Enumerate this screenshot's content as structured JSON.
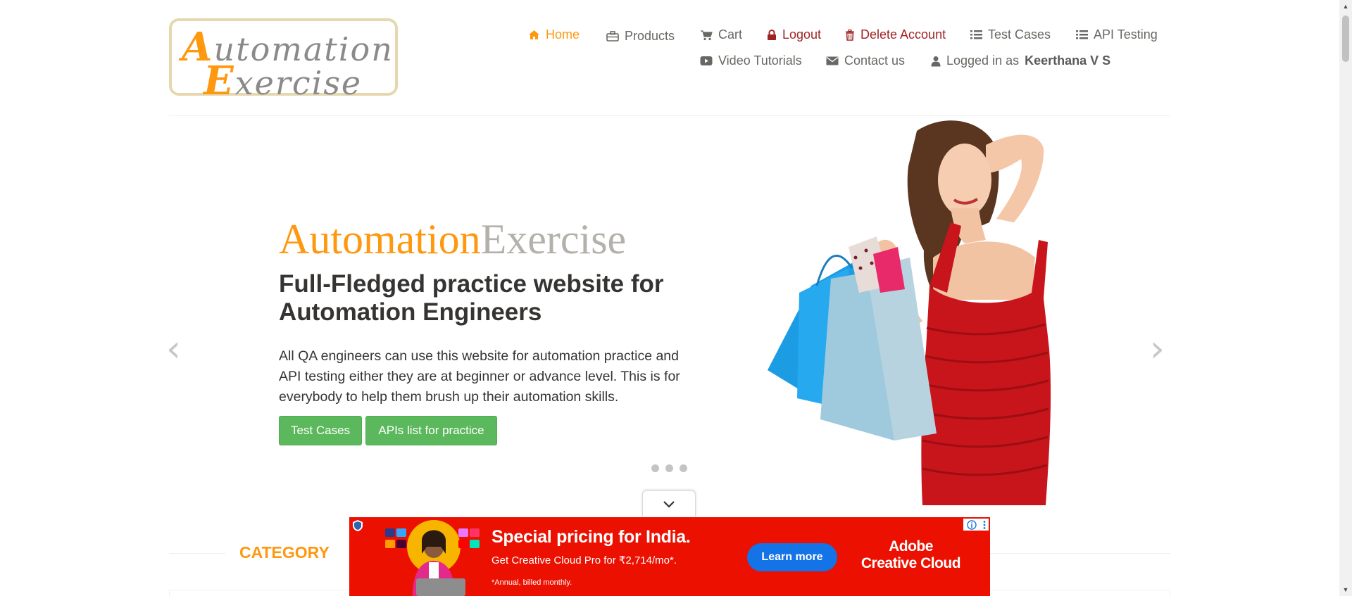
{
  "logo": {
    "line1_cap": "A",
    "line1_rest": "utomation",
    "line2_cap": "E",
    "line2_rest": "xercise"
  },
  "nav": {
    "home": "Home",
    "products": "Products",
    "cart": "Cart",
    "logout": "Logout",
    "delete_account": "Delete Account",
    "test_cases": "Test Cases",
    "api_testing": "API Testing",
    "video_tutorials": "Video Tutorials",
    "contact_us": "Contact us",
    "logged_in_prefix": "Logged in as",
    "logged_in_user": "Keerthana V S"
  },
  "hero": {
    "brand_part1": "Automation",
    "brand_part2": "Exercise",
    "heading": "Full-Fledged practice website for Automation Engineers",
    "description": "All QA engineers can use this website for automation practice and API testing either they are at beginner or advance level. This is for everybody to help them brush up their automation skills.",
    "btn_test_cases": "Test Cases",
    "btn_apis": "APIs list for practice",
    "prev_arrow": "‹",
    "next_arrow": "›",
    "carousel_dots": 3
  },
  "category": {
    "title": "CATEGORY"
  },
  "ad": {
    "headline": "Special pricing for India.",
    "sub": "Get Creative Cloud Pro for ₹2,714/mo*.",
    "note": "*Annual, billed monthly.",
    "cta": "Learn more",
    "brand_line1": "Adobe",
    "brand_line2": "Creative Cloud"
  },
  "colors": {
    "accent": "#fe980f",
    "nav_text": "#696763",
    "danger_link": "#a02323",
    "button_green": "#5cb85c",
    "ad_background": "#eb1000",
    "ad_cta": "#1473e6"
  },
  "icons": {
    "home": "home-icon",
    "products": "briefcase-icon",
    "cart": "cart-icon",
    "logout": "lock-icon",
    "delete_account": "trash-icon",
    "test_cases": "list-icon",
    "api_testing": "list-icon",
    "video_tutorials": "youtube-play-icon",
    "contact_us": "envelope-icon",
    "logged_in": "user-icon"
  }
}
